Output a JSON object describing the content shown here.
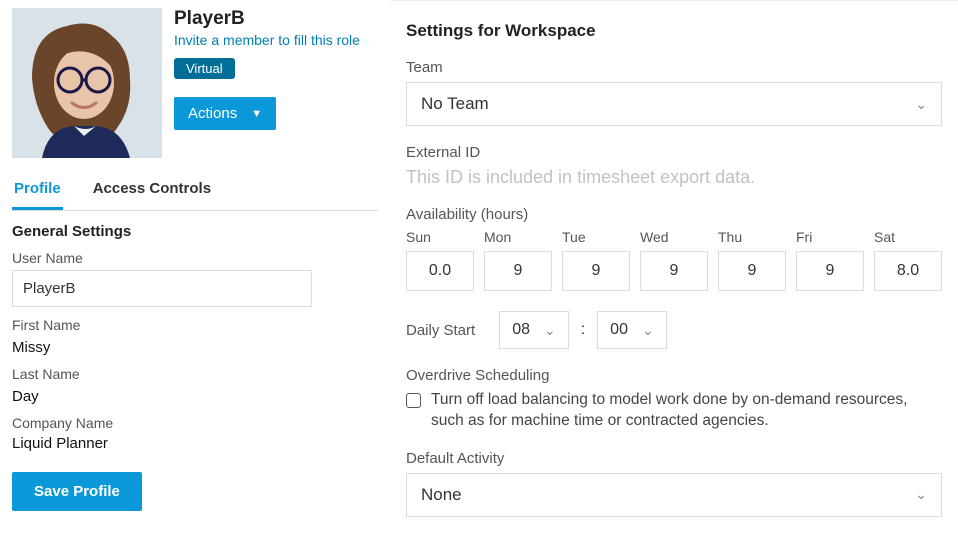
{
  "profile": {
    "name": "PlayerB",
    "invite_text": "Invite a member to fill this role",
    "badge": "Virtual",
    "actions_label": "Actions"
  },
  "tabs": {
    "profile": "Profile",
    "access": "Access Controls"
  },
  "general": {
    "title": "General Settings",
    "username_label": "User Name",
    "username_value": "PlayerB",
    "firstname_label": "First Name",
    "firstname_value": "Missy",
    "lastname_label": "Last Name",
    "lastname_value": "Day",
    "company_label": "Company Name",
    "company_value": "Liquid Planner",
    "save_label": "Save Profile"
  },
  "workspace": {
    "title": "Settings for Workspace",
    "team_label": "Team",
    "team_value": "No Team",
    "external_id_label": "External ID",
    "external_id_placeholder": "This ID is included in timesheet export data.",
    "availability_label": "Availability (hours)",
    "days": [
      {
        "label": "Sun",
        "value": "0.0"
      },
      {
        "label": "Mon",
        "value": "9"
      },
      {
        "label": "Tue",
        "value": "9"
      },
      {
        "label": "Wed",
        "value": "9"
      },
      {
        "label": "Thu",
        "value": "9"
      },
      {
        "label": "Fri",
        "value": "9"
      },
      {
        "label": "Sat",
        "value": "8.0"
      }
    ],
    "daily_start_label": "Daily Start",
    "daily_start_hour": "08",
    "daily_start_min": "00",
    "overdrive_label": "Overdrive Scheduling",
    "overdrive_text": "Turn off load balancing to model work done by on-demand resources, such as for machine time or contracted agencies.",
    "default_activity_label": "Default Activity",
    "default_activity_value": "None"
  }
}
